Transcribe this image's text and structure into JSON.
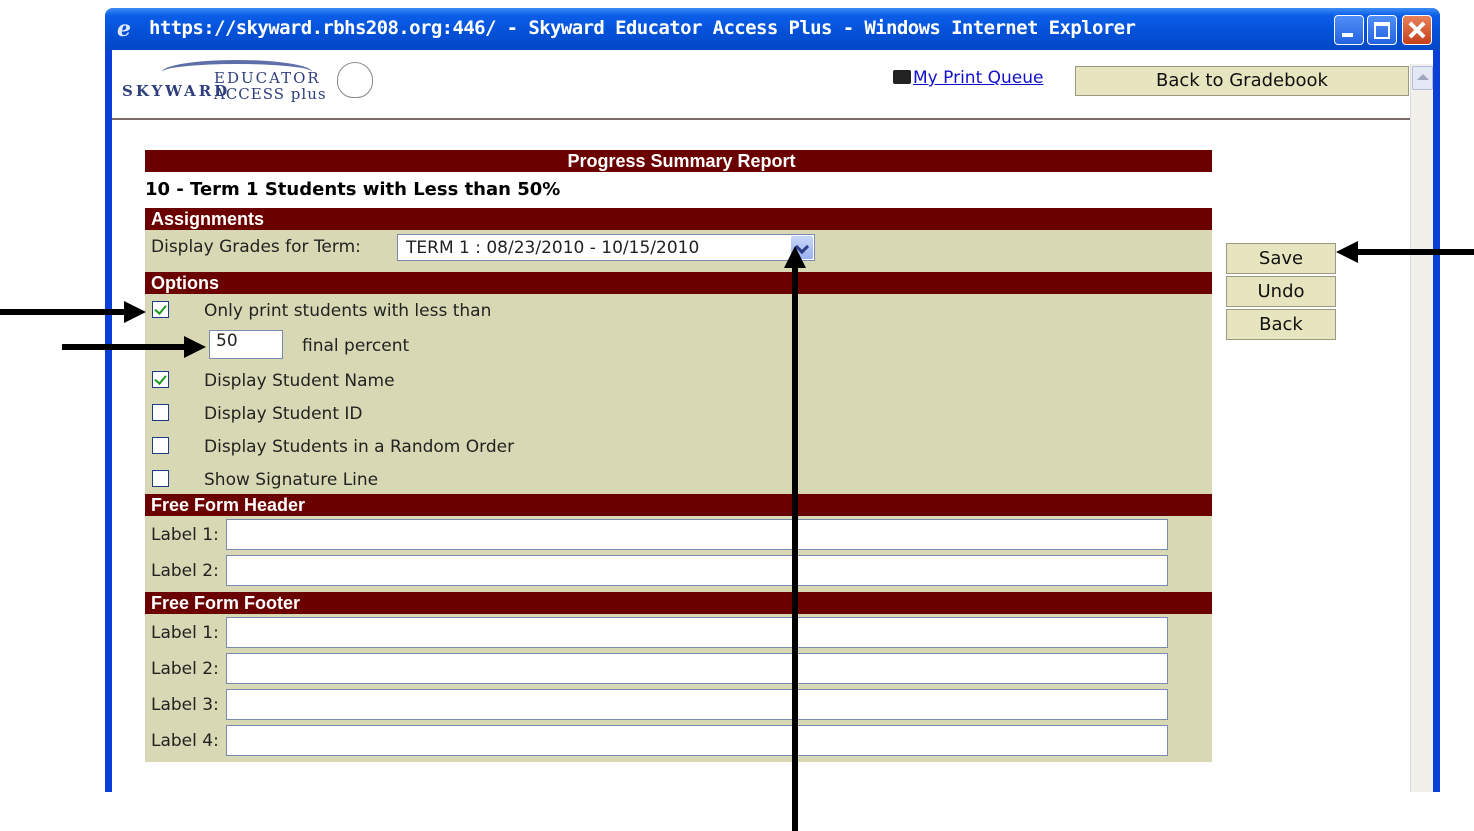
{
  "window": {
    "title": "https://skyward.rbhs208.org:446/ - Skyward Educator Access Plus - Windows Internet Explorer"
  },
  "header": {
    "logo_text_1": "SKYWARD",
    "logo_text_2": "EDUCATOR",
    "logo_text_3": "ACCESS plus",
    "print_queue_link": "My Print Queue",
    "back_to_gradebook": "Back to Gradebook"
  },
  "report": {
    "title": "Progress Summary Report",
    "subtitle": "10 -  Term 1 Students with Less than 50%"
  },
  "assignments": {
    "section_title": "Assignments",
    "term_label": "Display Grades for Term:",
    "term_selected": "TERM 1 : 08/23/2010 - 10/15/2010"
  },
  "options": {
    "section_title": "Options",
    "only_print_label": "Only print students with less than",
    "only_print_checked": true,
    "percent_value": "50",
    "final_percent_label": "final percent",
    "items": [
      {
        "label": "Display Student Name",
        "checked": true
      },
      {
        "label": "Display Student ID",
        "checked": false
      },
      {
        "label": "Display Students in a Random Order",
        "checked": false
      },
      {
        "label": "Show Signature Line",
        "checked": false
      }
    ]
  },
  "free_form_header": {
    "section_title": "Free Form Header",
    "labels": [
      "Label 1:",
      "Label 2:"
    ]
  },
  "free_form_footer": {
    "section_title": "Free Form Footer",
    "labels": [
      "Label 1:",
      "Label 2:",
      "Label 3:",
      "Label 4:"
    ]
  },
  "actions": {
    "save": "Save",
    "undo": "Undo",
    "back": "Back"
  },
  "colors": {
    "section_bar": "#6b0000",
    "panel_bg": "#d8d8b4",
    "button_bg": "#e7e5bf",
    "titlebar": "#0350d6"
  }
}
